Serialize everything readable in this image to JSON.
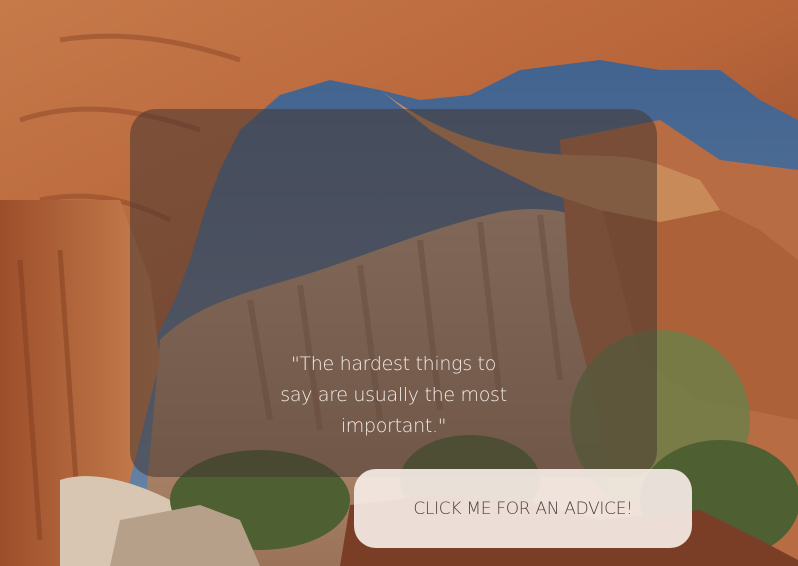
{
  "quote": {
    "text": "\"The hardest things to say are usually the most important.\""
  },
  "advice_button": {
    "label": "CLICK ME FOR AN ADVICE!"
  },
  "background": {
    "sky_color": "#4f6f95",
    "rock_color": "#b86a3c",
    "foliage_color": "#5a6b3a"
  }
}
